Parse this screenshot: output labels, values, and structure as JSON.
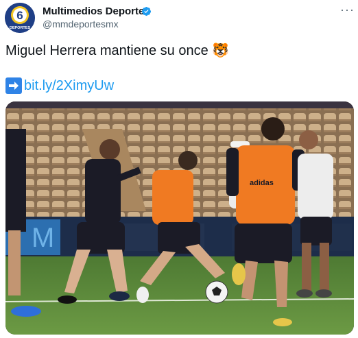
{
  "account": {
    "display_name": "Multimedios Deportes",
    "handle": "@mmdeportesmx",
    "avatar_label": "DEPORTES",
    "avatar_number": "6",
    "verified_icon": "verified-badge-icon"
  },
  "tweet": {
    "text": "Miguel Herrera mantiene su once",
    "emoji": "🐯",
    "link_icon": "right-arrow-emoji-icon",
    "link": "bit.ly/2XimyUw"
  },
  "menu": {
    "more_label": "···"
  },
  "photo": {
    "description_icon": "soccer-training-photo",
    "vest_brand": "adidas",
    "colors": {
      "vest": "#f07a22",
      "jersey": "#1b1b26",
      "grass": "#5f8a3a",
      "seats": "#c9a97e"
    }
  }
}
